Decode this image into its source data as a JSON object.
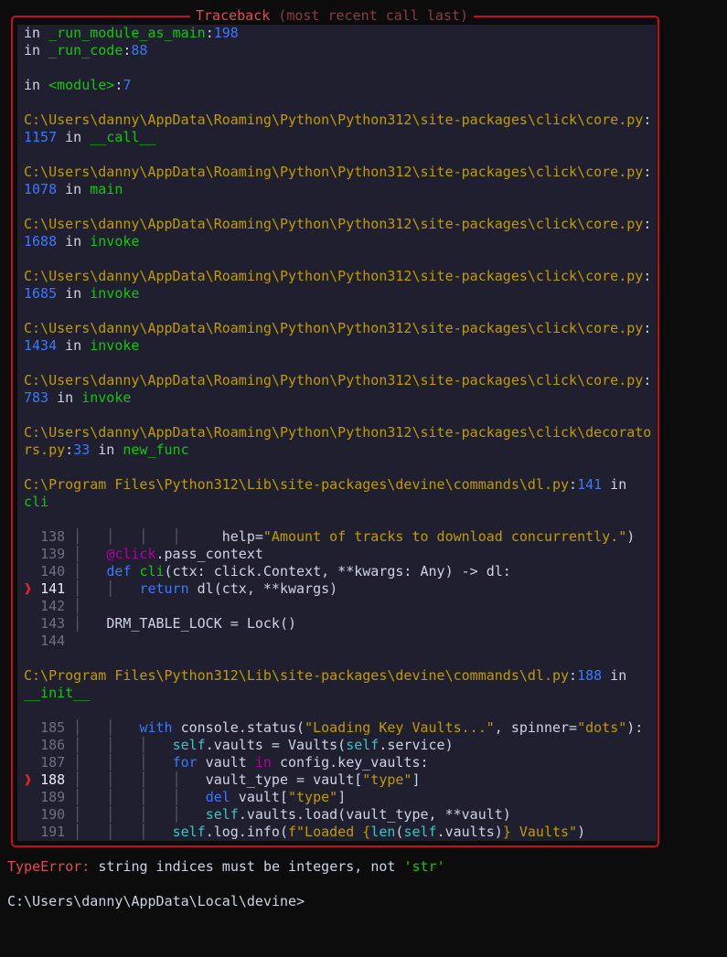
{
  "panel": {
    "title": "Traceback",
    "subtitle": " (most recent call last)"
  },
  "colors": {
    "border": "#c50f1f",
    "panel_bg": "#1f1f2f",
    "background": "#0c0c0c"
  },
  "traceback_lines": [
    [
      [
        "in ",
        "w"
      ],
      [
        "_run_module_as_main",
        "g"
      ],
      [
        ":",
        "w"
      ],
      [
        "198",
        "b"
      ]
    ],
    [
      [
        "in ",
        "w"
      ],
      [
        "_run_code",
        "g"
      ],
      [
        ":",
        "w"
      ],
      [
        "88",
        "b"
      ]
    ],
    [],
    [
      [
        "in ",
        "w"
      ],
      [
        "<module>",
        "g"
      ],
      [
        ":",
        "w"
      ],
      [
        "7",
        "b"
      ]
    ],
    [],
    [
      [
        "C:\\Users\\danny\\AppData\\Roaming\\Python\\Python312\\site-packages\\click\\core.py",
        "y"
      ],
      [
        ":",
        "w"
      ]
    ],
    [
      [
        "1157",
        "b"
      ],
      [
        " in ",
        "w"
      ],
      [
        "__call__",
        "g"
      ]
    ],
    [],
    [
      [
        "C:\\Users\\danny\\AppData\\Roaming\\Python\\Python312\\site-packages\\click\\core.py",
        "y"
      ],
      [
        ":",
        "w"
      ]
    ],
    [
      [
        "1078",
        "b"
      ],
      [
        " in ",
        "w"
      ],
      [
        "main",
        "g"
      ]
    ],
    [],
    [
      [
        "C:\\Users\\danny\\AppData\\Roaming\\Python\\Python312\\site-packages\\click\\core.py",
        "y"
      ],
      [
        ":",
        "w"
      ]
    ],
    [
      [
        "1688",
        "b"
      ],
      [
        " in ",
        "w"
      ],
      [
        "invoke",
        "g"
      ]
    ],
    [],
    [
      [
        "C:\\Users\\danny\\AppData\\Roaming\\Python\\Python312\\site-packages\\click\\core.py",
        "y"
      ],
      [
        ":",
        "w"
      ]
    ],
    [
      [
        "1685",
        "b"
      ],
      [
        " in ",
        "w"
      ],
      [
        "invoke",
        "g"
      ]
    ],
    [],
    [
      [
        "C:\\Users\\danny\\AppData\\Roaming\\Python\\Python312\\site-packages\\click\\core.py",
        "y"
      ],
      [
        ":",
        "w"
      ]
    ],
    [
      [
        "1434",
        "b"
      ],
      [
        " in ",
        "w"
      ],
      [
        "invoke",
        "g"
      ]
    ],
    [],
    [
      [
        "C:\\Users\\danny\\AppData\\Roaming\\Python\\Python312\\site-packages\\click\\core.py",
        "y"
      ],
      [
        ":",
        "w"
      ]
    ],
    [
      [
        "783",
        "b"
      ],
      [
        " in ",
        "w"
      ],
      [
        "invoke",
        "g"
      ]
    ],
    [],
    [
      [
        "C:\\Users\\danny\\AppData\\Roaming\\Python\\Python312\\site-packages\\click\\decorato",
        "y"
      ]
    ],
    [
      [
        "rs.py",
        "y"
      ],
      [
        ":",
        "w"
      ],
      [
        "33",
        "b"
      ],
      [
        " in ",
        "w"
      ],
      [
        "new_func",
        "g"
      ]
    ],
    [],
    [
      [
        "C:\\Program Files\\Python312\\Lib\\site-packages\\devine\\commands\\dl.py",
        "y"
      ],
      [
        ":",
        "w"
      ],
      [
        "141",
        "b"
      ],
      [
        " in",
        "w"
      ]
    ],
    [
      [
        "cli",
        "g"
      ]
    ],
    [],
    [
      [
        "  ",
        "w"
      ],
      [
        "138",
        "n"
      ],
      [
        " │   │   │   │     ",
        "gd"
      ],
      [
        "help=",
        "w"
      ],
      [
        "\"Amount of tracks to download concurrently.\"",
        "y"
      ],
      [
        ")",
        "w"
      ]
    ],
    [
      [
        "  ",
        "w"
      ],
      [
        "139",
        "n"
      ],
      [
        " │   ",
        "gd"
      ],
      [
        "@click",
        "m"
      ],
      [
        ".pass_context",
        "w"
      ]
    ],
    [
      [
        "  ",
        "w"
      ],
      [
        "140",
        "n"
      ],
      [
        " │   ",
        "gd"
      ],
      [
        "def",
        "k"
      ],
      [
        " ",
        "w"
      ],
      [
        "cli",
        "g"
      ],
      [
        "(ctx: click.Context, **kwargs: Any) -> dl:",
        "w"
      ]
    ],
    [
      [
        "❱ ",
        "r"
      ],
      [
        "141",
        "h"
      ],
      [
        " │   │   ",
        "gd"
      ],
      [
        "return",
        "k"
      ],
      [
        " dl(ctx, **kwargs)",
        "w"
      ]
    ],
    [
      [
        "  ",
        "w"
      ],
      [
        "142",
        "n"
      ],
      [
        " │",
        "gd"
      ]
    ],
    [
      [
        "  ",
        "w"
      ],
      [
        "143",
        "n"
      ],
      [
        " │   ",
        "gd"
      ],
      [
        "DRM_TABLE_LOCK = Lock()",
        "w"
      ]
    ],
    [
      [
        "  ",
        "w"
      ],
      [
        "144",
        "n"
      ]
    ],
    [],
    [
      [
        "C:\\Program Files\\Python312\\Lib\\site-packages\\devine\\commands\\dl.py",
        "y"
      ],
      [
        ":",
        "w"
      ],
      [
        "188",
        "b"
      ],
      [
        " in",
        "w"
      ]
    ],
    [
      [
        "__init__",
        "g"
      ]
    ],
    [],
    [
      [
        "  ",
        "w"
      ],
      [
        "185",
        "n"
      ],
      [
        " │   │   ",
        "gd"
      ],
      [
        "with",
        "k"
      ],
      [
        " console.status(",
        "w"
      ],
      [
        "\"Loading Key Vaults...\"",
        "y"
      ],
      [
        ", spinner=",
        "w"
      ],
      [
        "\"dots\"",
        "y"
      ],
      [
        "):",
        "w"
      ]
    ],
    [
      [
        "  ",
        "w"
      ],
      [
        "186",
        "n"
      ],
      [
        " │   │   │   ",
        "gd"
      ],
      [
        "self",
        "c"
      ],
      [
        ".vaults = Vaults(",
        "w"
      ],
      [
        "self",
        "c"
      ],
      [
        ".service)",
        "w"
      ]
    ],
    [
      [
        "  ",
        "w"
      ],
      [
        "187",
        "n"
      ],
      [
        " │   │   │   ",
        "gd"
      ],
      [
        "for",
        "k"
      ],
      [
        " vault ",
        "w"
      ],
      [
        "in",
        "m"
      ],
      [
        " config.key_vaults:",
        "w"
      ]
    ],
    [
      [
        "❱ ",
        "r"
      ],
      [
        "188",
        "h"
      ],
      [
        " │   │   │   │   ",
        "gd"
      ],
      [
        "vault_type = vault[",
        "w"
      ],
      [
        "\"type\"",
        "y"
      ],
      [
        "]",
        "w"
      ]
    ],
    [
      [
        "  ",
        "w"
      ],
      [
        "189",
        "n"
      ],
      [
        " │   │   │   │   ",
        "gd"
      ],
      [
        "del",
        "k"
      ],
      [
        " vault[",
        "w"
      ],
      [
        "\"type\"",
        "y"
      ],
      [
        "]",
        "w"
      ]
    ],
    [
      [
        "  ",
        "w"
      ],
      [
        "190",
        "n"
      ],
      [
        " │   │   │   │   ",
        "gd"
      ],
      [
        "self",
        "c"
      ],
      [
        ".vaults.load(vault_type, **vault)",
        "w"
      ]
    ],
    [
      [
        "  ",
        "w"
      ],
      [
        "191",
        "n"
      ],
      [
        " │   │   │   ",
        "gd"
      ],
      [
        "self",
        "c"
      ],
      [
        ".log.info(",
        "w"
      ],
      [
        "f\"Loaded {",
        "y"
      ],
      [
        "len",
        "c"
      ],
      [
        "(",
        "w"
      ],
      [
        "self",
        "c"
      ],
      [
        ".vaults)",
        "w"
      ],
      [
        "} Vaults\"",
        "y"
      ],
      [
        ")",
        "w"
      ]
    ]
  ],
  "error": {
    "type": "TypeError:",
    "message": " string indices must be integers, not ",
    "value": "'str'"
  },
  "prompt": "C:\\Users\\danny\\AppData\\Local\\devine>"
}
